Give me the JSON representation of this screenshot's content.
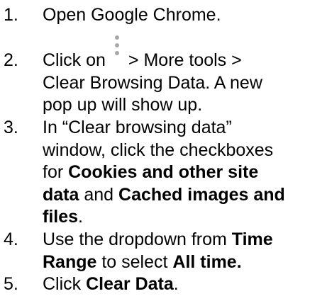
{
  "steps": [
    {
      "number": "1.",
      "text": "Open Google Chrome."
    },
    {
      "number": "2.",
      "prefix": "Click on",
      "icon": "three-dot-menu-icon",
      "line1_suffix": "> More tools >",
      "line2": "Clear Browsing Data. A new",
      "line3": "pop up will show up."
    },
    {
      "number": "3.",
      "line1": "In “Clear browsing data”",
      "line2": "window, click the checkboxes",
      "line3_pre": "for ",
      "line3_bold": "Cookies and other site",
      "line4_bold_a": "data",
      "line4_mid": " and ",
      "line4_bold_b": "Cached images and",
      "line5_bold": "files",
      "line5_post": "."
    },
    {
      "number": "4.",
      "line1_pre": "Use the dropdown from ",
      "line1_bold": "Time",
      "line2_bold": "Range",
      "line2_mid": " to select ",
      "line2_bold_b": "All time."
    },
    {
      "number": "5.",
      "pre": "Click ",
      "bold": "Clear Data",
      "post": "."
    }
  ]
}
